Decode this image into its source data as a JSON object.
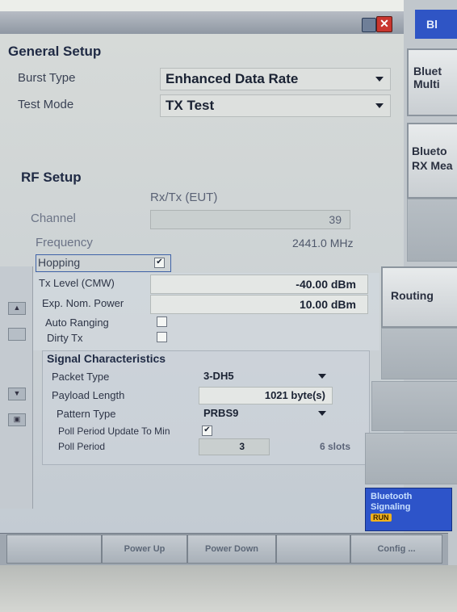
{
  "window": {
    "close_icon": "close-icon",
    "minimize_icon": "minimize-icon"
  },
  "general_setup": {
    "title": "General Setup",
    "burst_type": {
      "label": "Burst Type",
      "value": "Enhanced Data Rate"
    },
    "test_mode": {
      "label": "Test Mode",
      "value": "TX Test"
    }
  },
  "rf_setup": {
    "title": "RF Setup",
    "column_header": "Rx/Tx (EUT)",
    "channel": {
      "label": "Channel",
      "value": "39"
    },
    "frequency": {
      "label": "Frequency",
      "value": "2441.0 MHz"
    },
    "hopping": {
      "label": "Hopping",
      "checked": true
    },
    "tx_level": {
      "label": "Tx Level (CMW)",
      "value": "-40.00 dBm"
    },
    "exp_nom_power": {
      "label": "Exp. Nom. Power",
      "value": "10.00 dBm"
    },
    "auto_ranging": {
      "label": "Auto Ranging",
      "checked": false
    },
    "dirty_tx": {
      "label": "Dirty Tx",
      "checked": false
    }
  },
  "signal_characteristics": {
    "title": "Signal Characteristics",
    "packet_type": {
      "label": "Packet Type",
      "value": "3-DH5"
    },
    "payload_length": {
      "label": "Payload Length",
      "value": "1021 byte(s)"
    },
    "pattern_type": {
      "label": "Pattern Type",
      "value": "PRBS9"
    },
    "poll_period_update": {
      "label": "Poll Period Update To Min",
      "checked": true
    },
    "poll_period": {
      "label": "Poll Period",
      "value": "3",
      "slots": "6 slots"
    }
  },
  "softkeys": {
    "top_tab": "Bl",
    "key1": "Bluet Multi",
    "key2": "Blueto RX Mea",
    "key3": "Routing",
    "bt_signaling": {
      "line1": "Bluetooth",
      "line2": "Signaling",
      "badge": "RUN"
    }
  },
  "bottom_bar": {
    "power_up": "Power Up",
    "power_down": "Power Down",
    "config": "Config ..."
  }
}
